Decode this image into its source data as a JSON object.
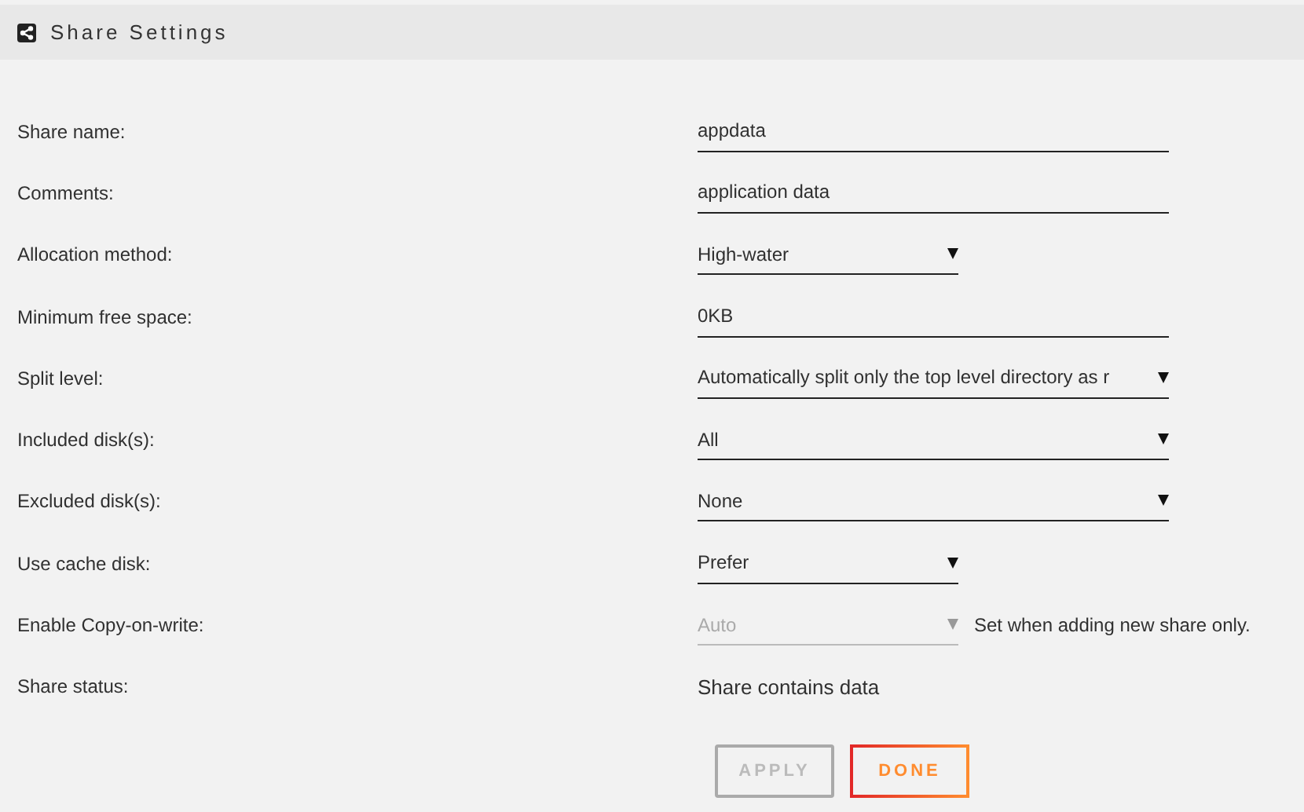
{
  "header": {
    "title": "Share Settings"
  },
  "fields": [
    {
      "label": "Share name:",
      "kind": "text",
      "value": "appdata",
      "disabled": false
    },
    {
      "label": "Comments:",
      "kind": "text",
      "value": "application data",
      "disabled": false
    },
    {
      "label": "Allocation method:",
      "kind": "select-short",
      "value": "High-water",
      "disabled": false
    },
    {
      "label": "Minimum free space:",
      "kind": "text",
      "value": "0KB",
      "disabled": false
    },
    {
      "label": "Split level:",
      "kind": "select",
      "value": "Automatically split only the top level directory as r",
      "disabled": false
    },
    {
      "label": "Included disk(s):",
      "kind": "select",
      "value": "All",
      "disabled": false
    },
    {
      "label": "Excluded disk(s):",
      "kind": "select",
      "value": "None",
      "disabled": false
    },
    {
      "label": "Use cache disk:",
      "kind": "select-short",
      "value": "Prefer",
      "disabled": false
    },
    {
      "label": "Enable Copy-on-write:",
      "kind": "select-short",
      "value": "Auto",
      "disabled": true,
      "note": "Set when adding new share only."
    },
    {
      "label": "Share status:",
      "kind": "status",
      "value": "Share contains data"
    }
  ],
  "buttons": [
    {
      "label": "APPLY",
      "disabled": true
    },
    {
      "label": "DONE",
      "disabled": false
    }
  ]
}
